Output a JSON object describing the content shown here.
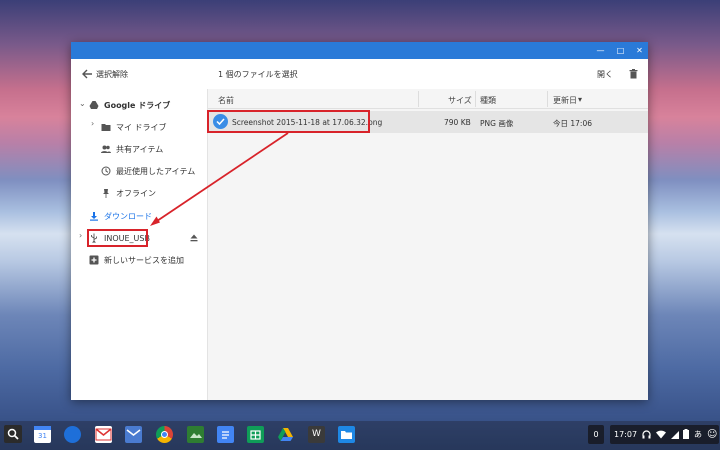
{
  "toolbar": {
    "back_label": "選択解除",
    "selection_status": "1 個のファイルを選択",
    "open_label": "開く"
  },
  "sidebar": {
    "items": [
      {
        "label": "Google ドライブ",
        "icon": "drive-icon"
      },
      {
        "label": "マイ ドライブ",
        "icon": "folder-icon"
      },
      {
        "label": "共有アイテム",
        "icon": "people-icon"
      },
      {
        "label": "最近使用したアイテム",
        "icon": "clock-icon"
      },
      {
        "label": "オフライン",
        "icon": "pin-icon"
      },
      {
        "label": "ダウンロード",
        "icon": "download-icon"
      },
      {
        "label": "INOUE_USB",
        "icon": "usb-icon"
      },
      {
        "label": "新しいサービスを追加",
        "icon": "plus-icon"
      }
    ]
  },
  "columns": {
    "name": "名前",
    "size": "サイズ",
    "type": "種類",
    "modified": "更新日"
  },
  "files": [
    {
      "name": "Screenshot 2015-11-18 at 17.06.32.png",
      "size": "790 KB",
      "type": "PNG 画像",
      "modified": "今日 17:06"
    }
  ],
  "shelf": {
    "calendar_day": "31",
    "notification_count": "0",
    "clock": "17:07",
    "ime": "あ"
  },
  "colors": {
    "titlebar": "#2a7ad8",
    "accent": "#1a73e8",
    "highlight": "#d8232a"
  }
}
